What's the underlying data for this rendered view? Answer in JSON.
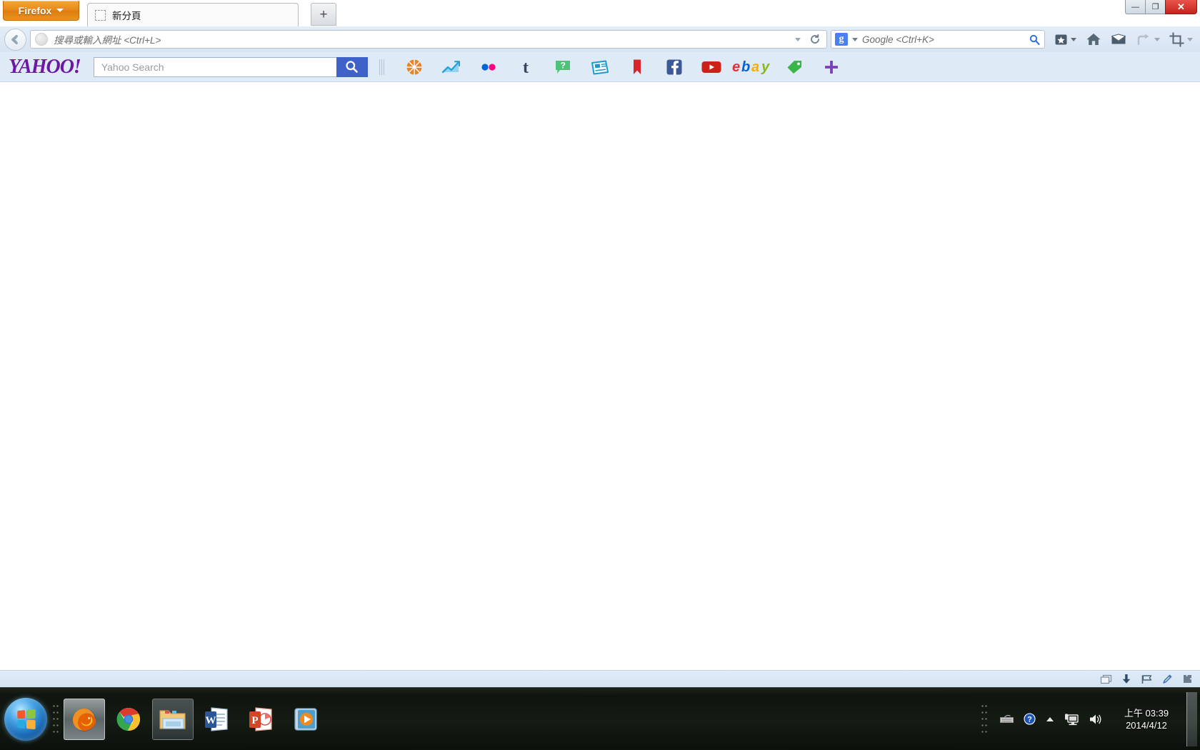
{
  "window": {
    "app_button_label": "Firefox",
    "controls": {
      "minimize": "—",
      "restore": "❐",
      "close": "✕"
    }
  },
  "tabs": [
    {
      "label": "新分頁",
      "favicon": "blank-page-icon",
      "active": true
    }
  ],
  "newtab_button_label": "+",
  "navbar": {
    "back_icon": "back-arrow-icon",
    "urlbar": {
      "value": "",
      "placeholder": "搜尋或輸入網址 <Ctrl+L>",
      "identity_icon": "globe-icon",
      "dropmarker_icon": "chevron-down-icon",
      "reload_icon": "reload-icon"
    },
    "searchbar": {
      "engine": "Google",
      "engine_badge": "g",
      "value": "",
      "placeholder": "Google <Ctrl+K>",
      "dropmarker_icon": "chevron-down-icon",
      "go_icon": "magnifier-icon"
    },
    "buttons": [
      {
        "name": "bookmarks-button",
        "icon": "star-box-icon",
        "has_caret": true
      },
      {
        "name": "home-button",
        "icon": "home-icon",
        "has_caret": false
      },
      {
        "name": "mail-button",
        "icon": "envelope-icon",
        "has_caret": false
      },
      {
        "name": "undo-close-tab-button",
        "icon": "undo-arrow-icon",
        "has_caret": true
      },
      {
        "name": "screenshot-button",
        "icon": "crop-frame-icon",
        "has_caret": true
      }
    ]
  },
  "yahoo_toolbar": {
    "logo_text": "YAHOO!",
    "logo_color": "#6b19a4",
    "search": {
      "value": "",
      "placeholder": "Yahoo Search",
      "button_icon": "magnifier-icon",
      "button_color": "#3f62c9"
    },
    "grip": "drag-grip",
    "buttons": [
      {
        "name": "yahoo-sports-button",
        "icon": "basketball-icon",
        "color": "#e8852a"
      },
      {
        "name": "yahoo-finance-button",
        "icon": "line-chart-icon",
        "color": "#4db3e8"
      },
      {
        "name": "flickr-button",
        "icon": "flickr-dots-icon",
        "color": "#0063dc"
      },
      {
        "name": "tumblr-button",
        "icon": "tumblr-t-icon",
        "color": "#35465c"
      },
      {
        "name": "yahoo-answers-button",
        "icon": "question-bubble-icon",
        "color": "#4ec17a"
      },
      {
        "name": "yahoo-news-button",
        "icon": "newspaper-icon",
        "color": "#1b9ad1"
      },
      {
        "name": "bookmarks-button",
        "icon": "red-bookmark-icon",
        "color": "#d8242a"
      },
      {
        "name": "facebook-button",
        "icon": "facebook-f-icon",
        "color": "#3b5998"
      },
      {
        "name": "youtube-button",
        "icon": "youtube-play-icon",
        "color": "#cd2019"
      },
      {
        "name": "ebay-button",
        "icon": "ebay-logo-icon",
        "color": "#e53238"
      },
      {
        "name": "shopping-tag-button",
        "icon": "green-tag-icon",
        "color": "#39b54a"
      },
      {
        "name": "add-app-button",
        "icon": "plus-icon",
        "color": "#7b3fb8"
      }
    ]
  },
  "content": {
    "page": "about:newtab",
    "body_text": ""
  },
  "addonbar": {
    "icons": [
      {
        "name": "window-stack-icon"
      },
      {
        "name": "download-arrow-icon"
      },
      {
        "name": "flag-icon"
      },
      {
        "name": "pen-icon"
      },
      {
        "name": "puzzle-icon"
      }
    ]
  },
  "taskbar": {
    "start_label": "start-orb",
    "pinned": [
      {
        "name": "taskbar-firefox",
        "label": "Mozilla Firefox",
        "state": "active"
      },
      {
        "name": "taskbar-chrome",
        "label": "Google Chrome",
        "state": "pinned"
      },
      {
        "name": "taskbar-explorer",
        "label": "Windows Explorer",
        "state": "running"
      },
      {
        "name": "taskbar-word",
        "label": "Microsoft Word",
        "state": "pinned"
      },
      {
        "name": "taskbar-powerpoint",
        "label": "Microsoft PowerPoint",
        "state": "pinned"
      },
      {
        "name": "taskbar-media-player",
        "label": "Windows Media Player",
        "state": "pinned"
      }
    ],
    "tray": [
      {
        "name": "tray-keyboard-icon"
      },
      {
        "name": "tray-help-icon"
      },
      {
        "name": "tray-show-hidden-icon"
      },
      {
        "name": "tray-network-icon"
      },
      {
        "name": "tray-volume-icon"
      }
    ],
    "clock": {
      "time": "上午 03:39",
      "date": "2014/4/12"
    }
  }
}
